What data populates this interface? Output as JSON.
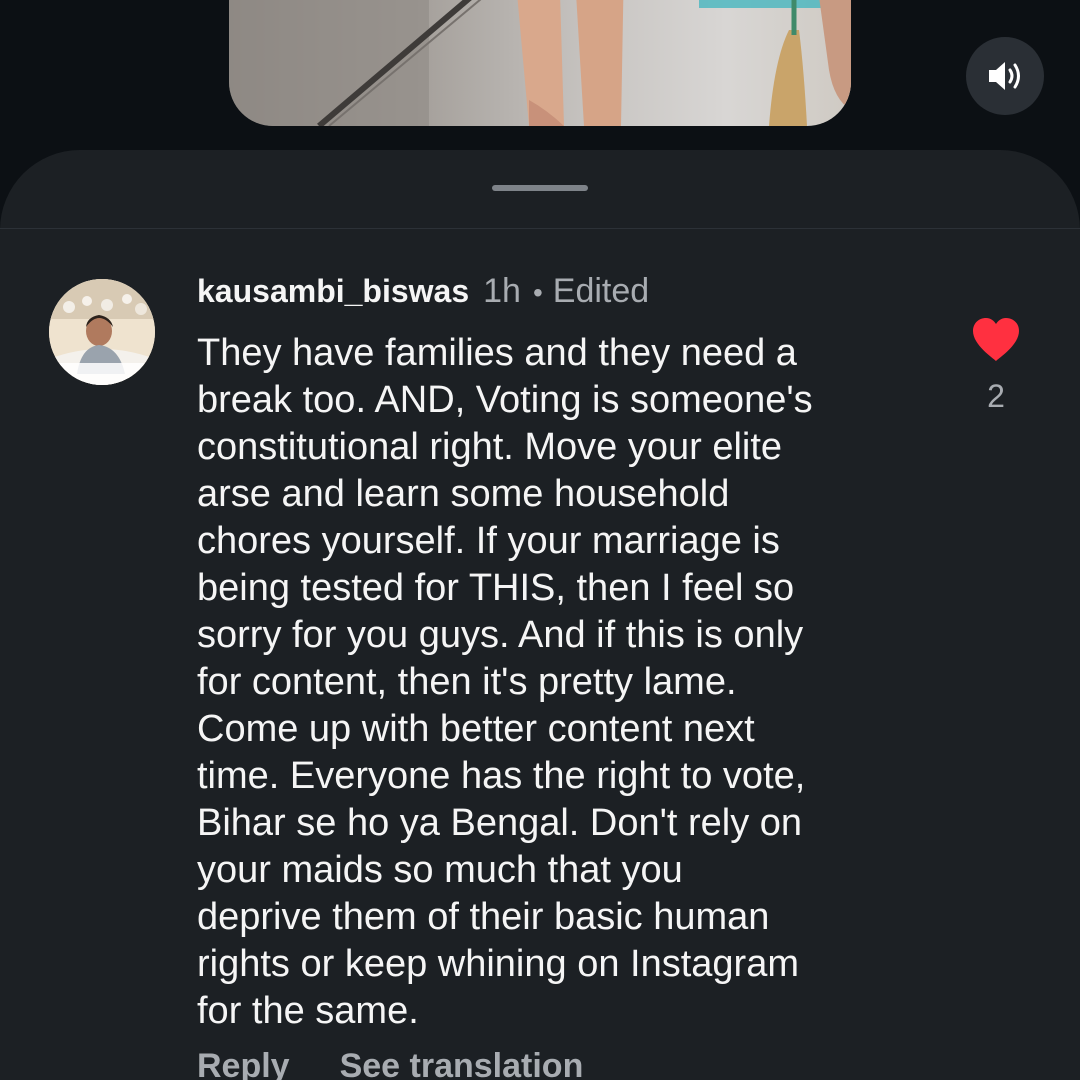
{
  "video": {
    "sound_icon": "speaker-volume-icon"
  },
  "comment": {
    "username": "kausambi_biswas",
    "time": "1h",
    "separator": "•",
    "edited_label": "Edited",
    "text": "They have families and they need a\nbreak too. AND, Voting is someone's\nconstitutional right. Move your elite\narse and learn some household\nchores yourself. If your marriage is\nbeing tested for THIS, then I feel so\nsorry for you guys. And if this is only\nfor content, then it's pretty lame.\nCome up with better content next\ntime. Everyone has the right to vote,\nBihar se ho ya Bengal. Don't rely on\nyour maids so much that you\ndeprive them of their basic human\nrights or keep whining on Instagram\nfor the same.",
    "like_count": "2",
    "like_icon": "heart-filled-icon",
    "liked_color": "#ff3040",
    "actions": {
      "reply": "Reply",
      "see_translation": "See translation"
    }
  }
}
